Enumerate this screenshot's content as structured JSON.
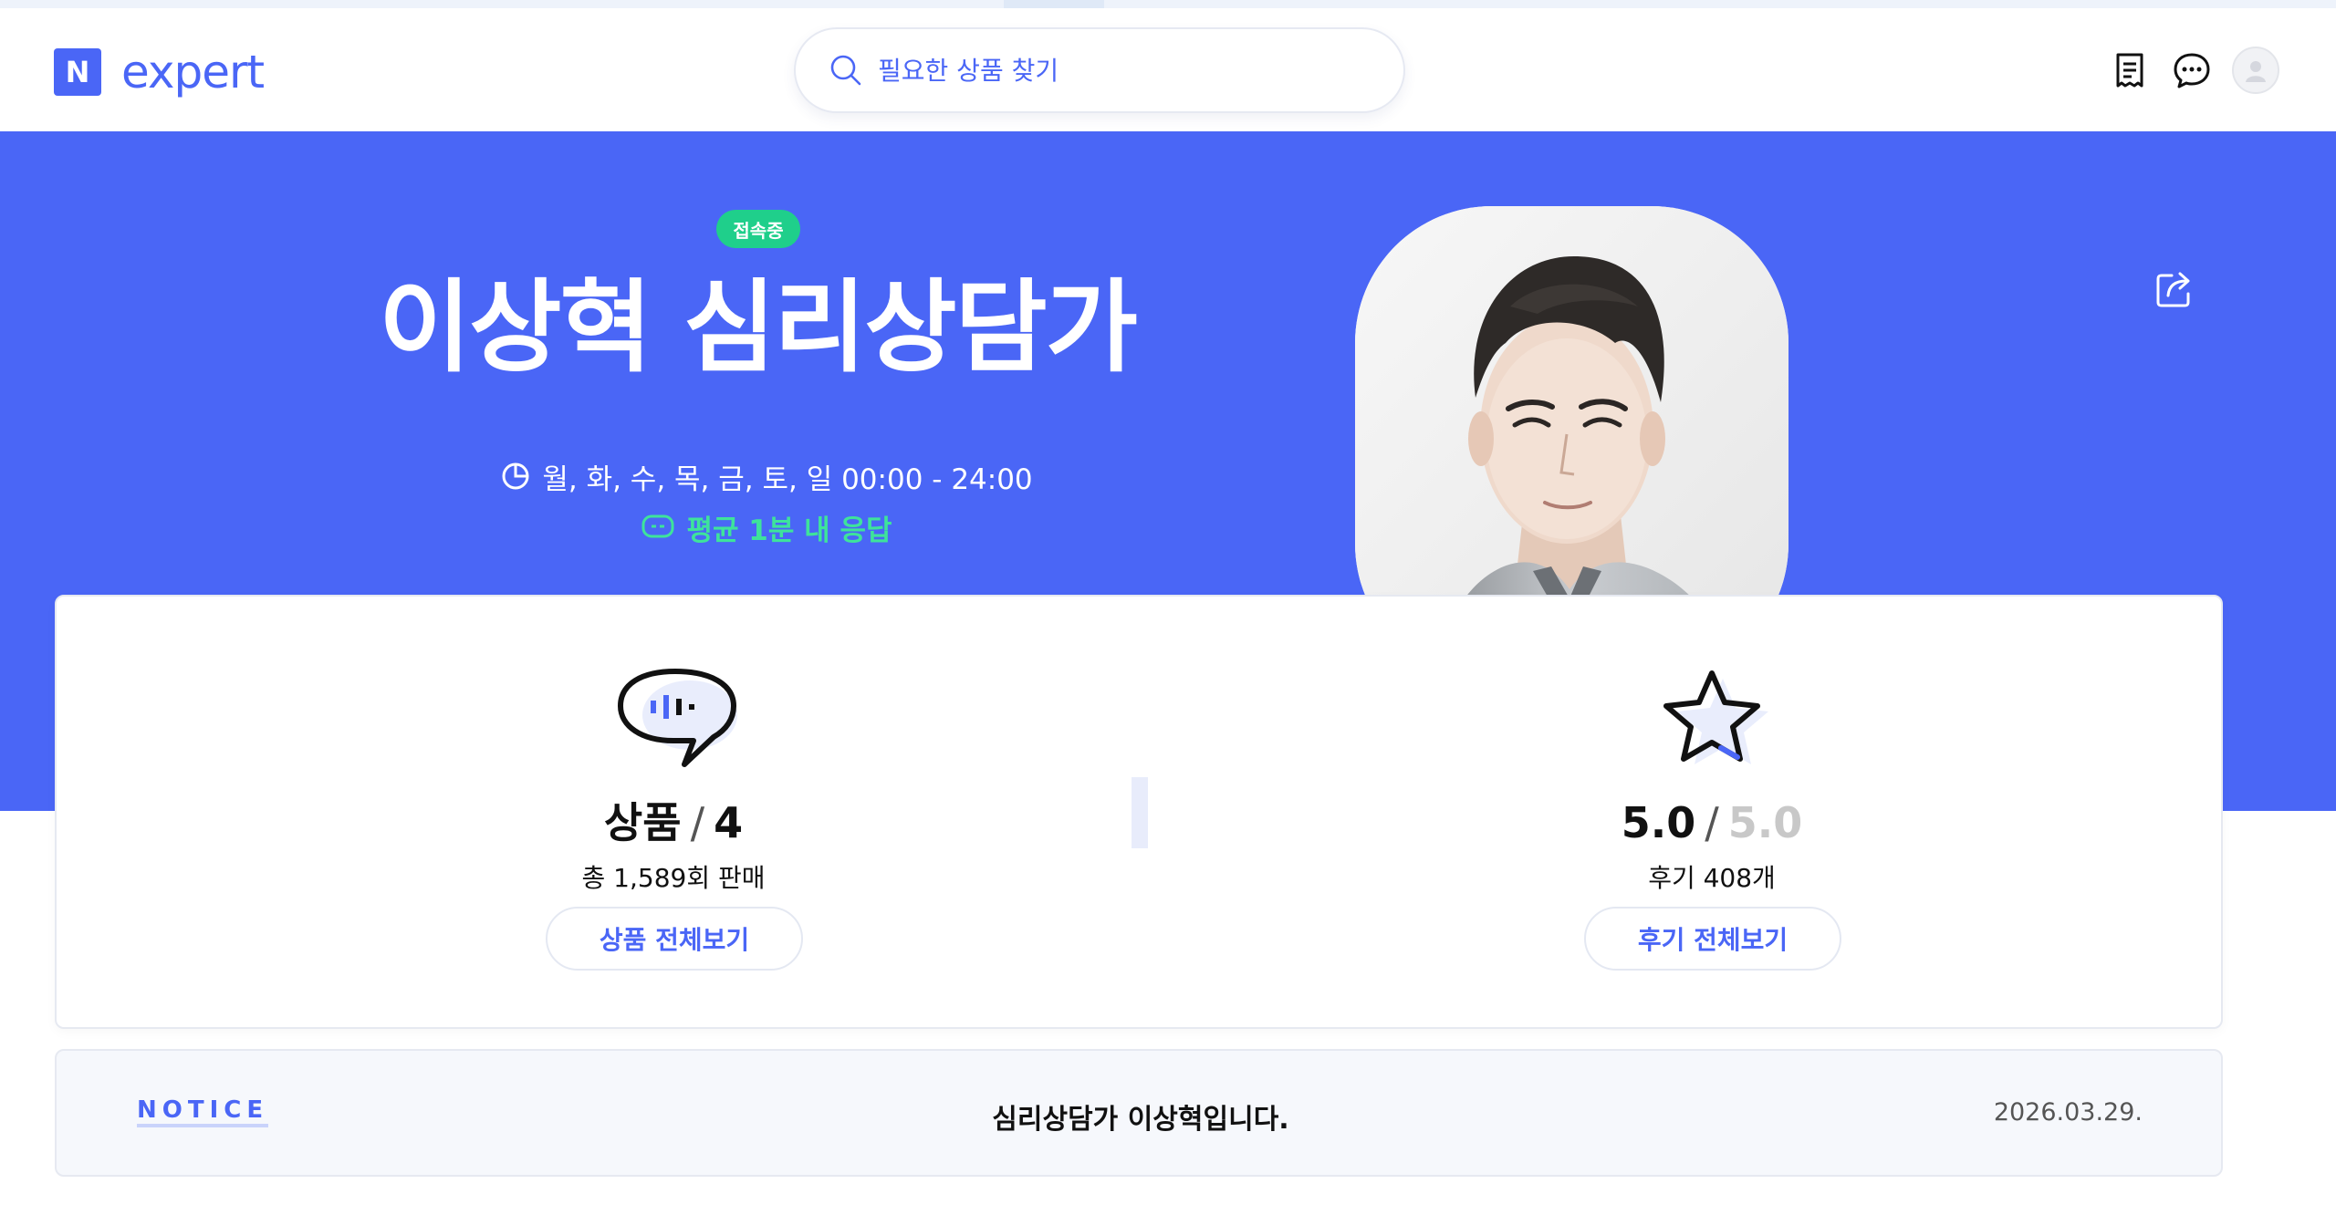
{
  "header": {
    "logo_badge": "N",
    "logo_text": "expert",
    "search_placeholder": "필요한 상품 찾기"
  },
  "hero": {
    "status_badge": "접속중",
    "title": "이상혁 심리상담가",
    "hours": "월, 화, 수, 목, 금, 토, 일 00:00 - 24:00",
    "response": "평균 1분 내 응답"
  },
  "stats": {
    "products": {
      "label": "상품",
      "count": "4",
      "sub": "총 1,589회 판매",
      "button": "상품 전체보기"
    },
    "reviews": {
      "score": "5.0",
      "max": "5.0",
      "sub": "후기 408개",
      "button": "후기 전체보기"
    }
  },
  "notice": {
    "label": "NOTICE",
    "text": "심리상담가 이상혁입니다.",
    "date": "2026.03.29."
  },
  "colors": {
    "brand": "#4a66f6",
    "online": "#1fcf8b",
    "response": "#3ee39b"
  },
  "icons": [
    "search-icon",
    "receipt-icon",
    "chat-icon",
    "user-icon",
    "clock-icon",
    "response-icon",
    "share-icon",
    "speech-bubble-icon",
    "star-icon"
  ]
}
